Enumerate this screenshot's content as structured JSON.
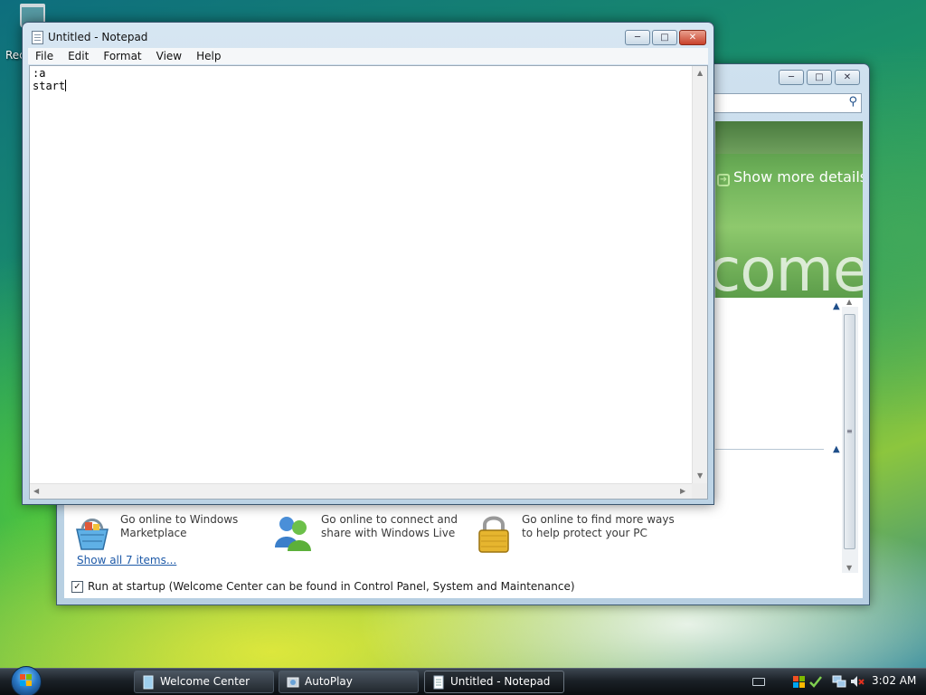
{
  "desktop": {
    "recycle_bin_label": "Rec"
  },
  "welcome_center": {
    "show_more_details": "Show more details",
    "header_partial_word": "come",
    "tasks": [
      {
        "label": "Go online to Windows Marketplace",
        "line1": "Go online to Windows",
        "line2": "Marketplace",
        "icon": "shopping-basket-icon"
      },
      {
        "label": "Go online to connect and share with Windows Live",
        "line1": "Go online to connect and",
        "line2": "share with Windows Live",
        "icon": "windows-live-users-icon"
      },
      {
        "label": "Go online to find more ways to help protect your PC",
        "line1": "Go online to find more ways",
        "line2": "to help protect your PC",
        "icon": "padlock-icon"
      }
    ],
    "show_all": "Show all 7 items...",
    "run_at_startup": "Run at startup (Welcome Center can be found in Control Panel, System and Maintenance)",
    "run_at_startup_checked": true
  },
  "notepad": {
    "title": "Untitled - Notepad",
    "menu": [
      "File",
      "Edit",
      "Format",
      "View",
      "Help"
    ],
    "content_lines": [
      ":a",
      "start"
    ]
  },
  "taskbar": {
    "buttons": [
      {
        "label": "Welcome Center",
        "active": false
      },
      {
        "label": "AutoPlay",
        "active": false
      },
      {
        "label": "Untitled - Notepad",
        "active": true
      }
    ],
    "clock": "3:02 AM"
  },
  "colors": {
    "link": "#1e5aa8",
    "close_button": "#c8412a",
    "taskbar": "#1b2127"
  }
}
